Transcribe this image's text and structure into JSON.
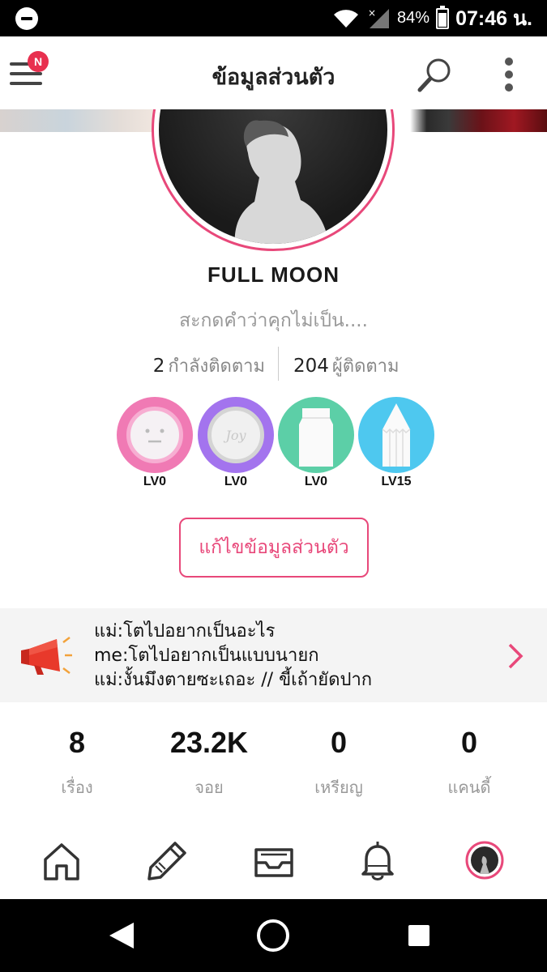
{
  "status_bar": {
    "battery": "84%",
    "time": "07:46 น."
  },
  "header": {
    "title": "ข้อมูลส่วนตัว",
    "notification_badge": "N",
    "icons": [
      "menu-icon",
      "search-icon",
      "more-vert-icon"
    ]
  },
  "profile": {
    "name": "FULL MOON",
    "bio": "สะกดคำว่าคุกไม่เป็น....",
    "following_count": "2",
    "following_label": "กำลังติดตาม",
    "followers_count": "204",
    "followers_label": "ผู้ติดตาม",
    "edit_button": "แก้ไขข้อมูลส่วนตัว"
  },
  "badges": [
    {
      "level": "LV0",
      "color": "#f07ab4",
      "icon": "face-coin-icon"
    },
    {
      "level": "LV0",
      "color": "#a374ee",
      "icon": "joy-coin-icon"
    },
    {
      "level": "LV0",
      "color": "#5ccfa7",
      "icon": "paper-bag-icon"
    },
    {
      "level": "LV15",
      "color": "#4ec8ef",
      "icon": "pencil-icon"
    }
  ],
  "announcement": {
    "lines": [
      "แม่:โตไปอยากเป็นอะไร",
      "me:โตไปอยากเป็นแบบนายก",
      "แม่:งั้นมึงตายซะเถอะ // ขี้เถ้ายัดปาก"
    ]
  },
  "stats": [
    {
      "value": "8",
      "label": "เรื่อง"
    },
    {
      "value": "23.2K",
      "label": "จอย"
    },
    {
      "value": "0",
      "label": "เหรียญ"
    },
    {
      "value": "0",
      "label": "แคนดี้"
    }
  ],
  "bottom_nav": [
    "home-icon",
    "write-icon",
    "inbox-icon",
    "bell-icon",
    "profile-avatar"
  ],
  "colors": {
    "accent": "#e8487a",
    "badge_red": "#e8304f"
  }
}
